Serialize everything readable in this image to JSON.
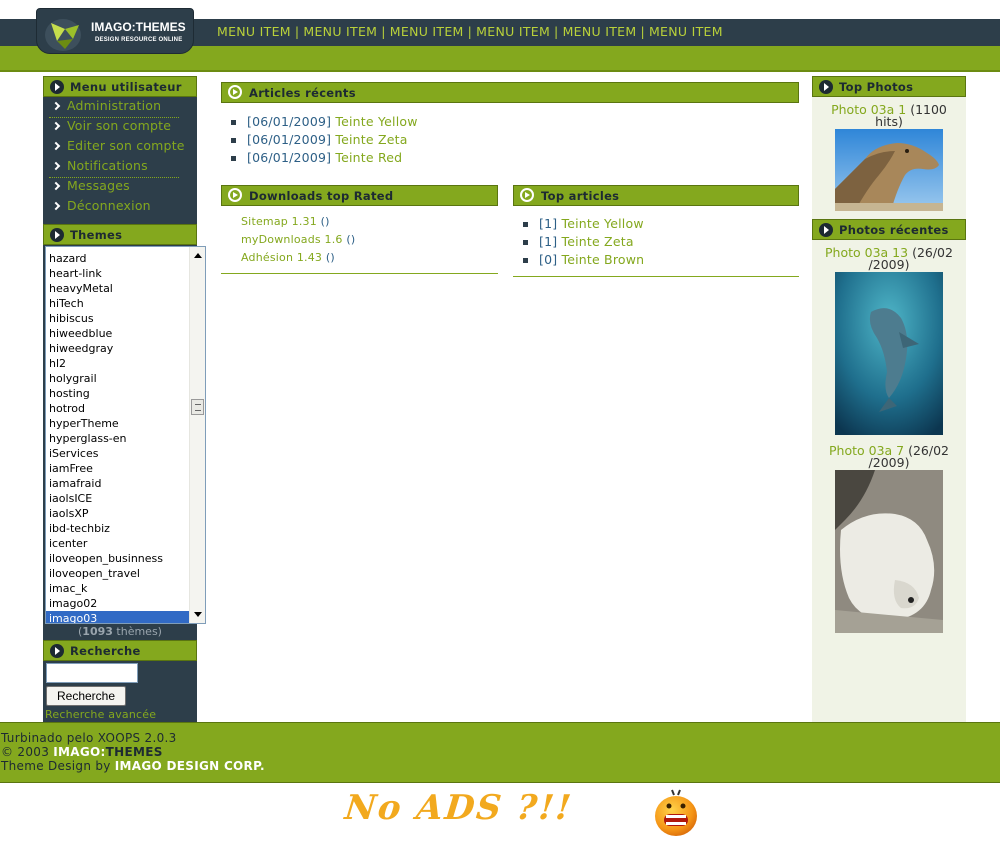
{
  "header": {
    "logo_main": "IMAGO:",
    "logo_accent": "THEMES",
    "logo_sub": "DESIGN RESOURCE ONLINE",
    "menu": [
      "MENU ITEM",
      "MENU ITEM",
      "MENU ITEM",
      "MENU ITEM",
      "MENU ITEM",
      "MENU ITEM"
    ]
  },
  "left": {
    "usermenu_title": "Menu utilisateur",
    "usermenu": [
      "Administration",
      "Voir son compte",
      "Editer son compte",
      "Notifications",
      "Messages",
      "Déconnexion"
    ],
    "themes_title": "Themes",
    "themes": [
      "hazard",
      "heart-link",
      "heavyMetal",
      "hiTech",
      "hibiscus",
      "hiweedblue",
      "hiweedgray",
      "hl2",
      "holygrail",
      "hosting",
      "hotrod",
      "hyperTheme",
      "hyperglass-en",
      "iServices",
      "iamFree",
      "iamafraid",
      "iaolsICE",
      "iaolsXP",
      "ibd-techbiz",
      "icenter",
      "iloveopen_businness",
      "iloveopen_travel",
      "imac_k",
      "imago02",
      "imago03"
    ],
    "themes_selected": "imago03",
    "theme_count_open": "(",
    "theme_count": "1093",
    "theme_count_suffix": " thèmes)",
    "search_title": "Recherche",
    "search_value": "",
    "search_button": "Recherche",
    "advanced_search": "Recherche avancée"
  },
  "center": {
    "recent_title": "Articles récents",
    "recent": [
      {
        "date": "[06/01/2009]",
        "title": "Teinte Yellow"
      },
      {
        "date": "[06/01/2009]",
        "title": "Teinte Zeta"
      },
      {
        "date": "[06/01/2009]",
        "title": "Teinte Red"
      }
    ],
    "downloads_title": "Downloads top Rated",
    "downloads": [
      {
        "name": "Sitemap 1.31",
        "extra": " ()"
      },
      {
        "name": "myDownloads 1.6",
        "extra": " ()"
      },
      {
        "name": "Adhésion 1.43",
        "extra": " ()"
      }
    ],
    "top_title": "Top articles",
    "top": [
      {
        "count": "[1]",
        "title": "Teinte Yellow"
      },
      {
        "count": "[1]",
        "title": "Teinte Zeta"
      },
      {
        "count": "[0]",
        "title": "Teinte Brown"
      }
    ]
  },
  "right": {
    "top_photos_title": "Top Photos",
    "top_photo_name": "Photo 03a 1",
    "top_photo_hits_a": " (1100",
    "top_photo_hits_b": "hits)",
    "recent_photos_title": "Photos récentes",
    "recent_photo1_name": "Photo 03a 13",
    "recent_photo1_date_a": " (26/02",
    "recent_photo1_date_b": "/2009)",
    "recent_photo2_name": "Photo 03a 7",
    "recent_photo2_date_a": " (26/02",
    "recent_photo2_date_b": "/2009)"
  },
  "footer": {
    "line1": "Turbinado pelo XOOPS 2.0.3",
    "line2_prefix": "© 2003 ",
    "line2_brand_a": "IMAGO:",
    "line2_brand_b": "THEMES",
    "line3_prefix": "Theme Design by ",
    "line3_brand": "IMAGO DESIGN CORP."
  },
  "banner": {
    "text": "No ADS ?!!"
  },
  "colors": {
    "dark": "#2d3e4a",
    "green": "#84a81e",
    "link": "#2d5f86",
    "selected": "#316ac5"
  }
}
